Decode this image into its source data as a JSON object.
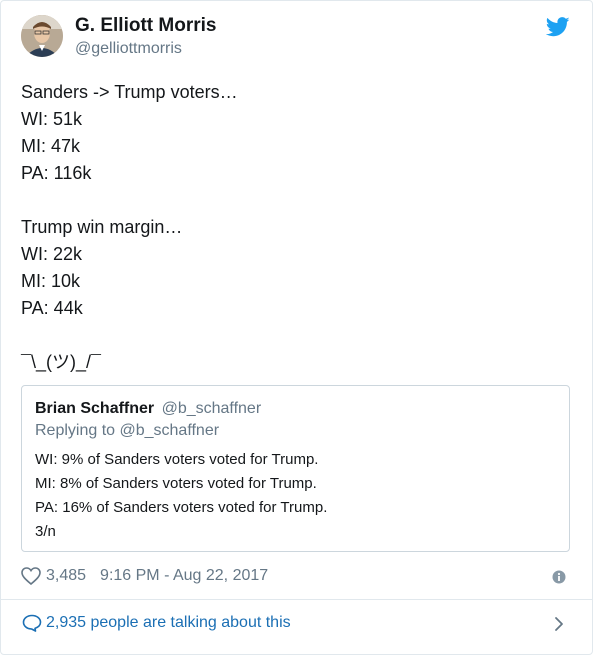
{
  "author": {
    "name": "G. Elliott Morris",
    "handle": "@gelliottmorris"
  },
  "tweet": {
    "lines": [
      "Sanders -> Trump voters…",
      "WI: 51k",
      "MI: 47k",
      "PA: 116k",
      "",
      "Trump win margin…",
      "WI: 22k",
      "MI: 10k",
      "PA: 44k",
      "",
      "¯\\_(ツ)_/¯"
    ]
  },
  "quoted": {
    "name": "Brian Schaffner",
    "handle": "@b_schaffner",
    "reply_to": "Replying to @b_schaffner",
    "lines": [
      "WI: 9% of Sanders voters voted for Trump.",
      "MI: 8% of Sanders voters voted for Trump.",
      "PA: 16% of Sanders voters voted for Trump.",
      "3/n"
    ]
  },
  "meta": {
    "likes": "3,485",
    "timestamp": "9:16 PM - Aug 22, 2017"
  },
  "footer": {
    "talking": "2,935 people are talking about this"
  },
  "icons": {
    "platform": "twitter-bird-icon",
    "like": "heart-icon",
    "info": "info-icon",
    "conversation": "speech-bubble-icon",
    "more": "chevron-right-icon"
  },
  "colors": {
    "twitter_blue": "#1da1f2",
    "link_blue": "#1b6fb4",
    "secondary_text": "#657786",
    "border": "#e1e8ed"
  }
}
